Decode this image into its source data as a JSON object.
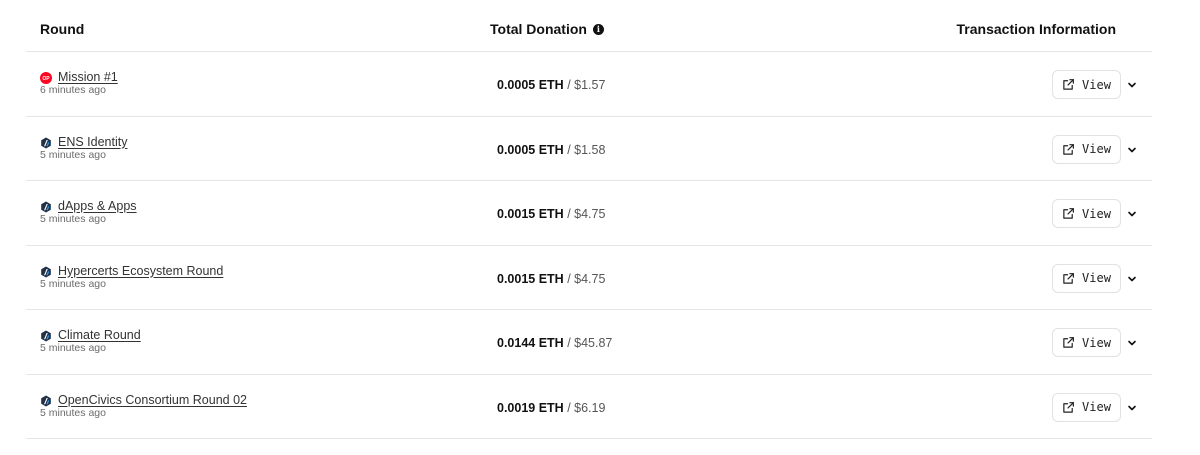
{
  "header": {
    "round": "Round",
    "total_donation": "Total Donation",
    "info_glyph": "i",
    "transaction_information": "Transaction Information"
  },
  "rows": [
    {
      "chain_icon": "optimism-icon",
      "name": "Mission #1",
      "time": "6 minutes ago",
      "eth": "0.0005 ETH",
      "separator": " / ",
      "usd": "$1.57",
      "view_label": "View"
    },
    {
      "chain_icon": "arbitrum-icon",
      "name": "ENS Identity",
      "time": "5 minutes ago",
      "eth": "0.0005 ETH",
      "separator": " / ",
      "usd": "$1.58",
      "view_label": "View"
    },
    {
      "chain_icon": "arbitrum-icon",
      "name": "dApps & Apps",
      "time": "5 minutes ago",
      "eth": "0.0015 ETH",
      "separator": " / ",
      "usd": "$4.75",
      "view_label": "View"
    },
    {
      "chain_icon": "arbitrum-icon",
      "name": "Hypercerts Ecosystem Round",
      "time": "5 minutes ago",
      "eth": "0.0015 ETH",
      "separator": " / ",
      "usd": "$4.75",
      "view_label": "View"
    },
    {
      "chain_icon": "arbitrum-icon",
      "name": "Climate Round",
      "time": "5 minutes ago",
      "eth": "0.0144 ETH",
      "separator": " / ",
      "usd": "$45.87",
      "view_label": "View"
    },
    {
      "chain_icon": "arbitrum-icon",
      "name": "OpenCivics Consortium Round 02",
      "time": "5 minutes ago",
      "eth": "0.0019 ETH",
      "separator": " / ",
      "usd": "$6.19",
      "view_label": "View"
    }
  ],
  "colors": {
    "optimism_red": "#ff0420",
    "arbitrum_navy": "#213147",
    "arbitrum_blue": "#28a0f0",
    "divider": "#e6e6e6"
  }
}
